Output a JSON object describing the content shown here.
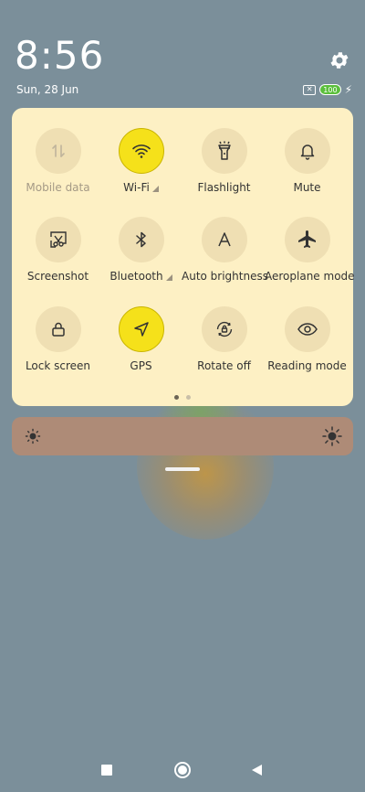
{
  "status": {
    "time": "8:56",
    "date": "Sun, 28 Jun",
    "battery": "100",
    "icons": [
      "settings-gear-icon",
      "sim-disabled-icon",
      "battery-icon",
      "charging-bolt-icon"
    ]
  },
  "tiles": [
    {
      "label": "Mobile data",
      "icon": "mobile-data-icon",
      "active": false,
      "disabled": true,
      "has_arrow": false
    },
    {
      "label": "Wi-Fi",
      "icon": "wifi-icon",
      "active": true,
      "disabled": false,
      "has_arrow": true
    },
    {
      "label": "Flashlight",
      "icon": "flashlight-icon",
      "active": false,
      "disabled": false,
      "has_arrow": false
    },
    {
      "label": "Mute",
      "icon": "bell-icon",
      "active": false,
      "disabled": false,
      "has_arrow": false
    },
    {
      "label": "Screenshot",
      "icon": "screenshot-icon",
      "active": false,
      "disabled": false,
      "has_arrow": false
    },
    {
      "label": "Bluetooth",
      "icon": "bluetooth-icon",
      "active": false,
      "disabled": false,
      "has_arrow": true
    },
    {
      "label": "Auto brightness",
      "icon": "auto-brightness-icon",
      "active": false,
      "disabled": false,
      "has_arrow": false
    },
    {
      "label": "Aeroplane mode",
      "icon": "airplane-icon",
      "active": false,
      "disabled": false,
      "has_arrow": false
    },
    {
      "label": "Lock screen",
      "icon": "lock-icon",
      "active": false,
      "disabled": false,
      "has_arrow": false
    },
    {
      "label": "GPS",
      "icon": "location-arrow-icon",
      "active": true,
      "disabled": false,
      "has_arrow": false
    },
    {
      "label": "Rotate off",
      "icon": "rotate-lock-icon",
      "active": false,
      "disabled": false,
      "has_arrow": false
    },
    {
      "label": "Reading mode",
      "icon": "eye-icon",
      "active": false,
      "disabled": false,
      "has_arrow": false
    }
  ],
  "pager": {
    "pages": 2,
    "current": 1
  },
  "brightness": {
    "level": 0.0
  },
  "colors": {
    "panel_bg": "#fdf0c4",
    "tile_bg": "#efdfb3",
    "tile_active": "#f5e11a",
    "brightness_bar": "#ae8b77",
    "wallpaper": "#7b8f9a",
    "battery_green": "#5bbf3c"
  },
  "navbar": {
    "buttons": [
      "recents-square-icon",
      "home-circle-icon",
      "back-triangle-icon"
    ]
  }
}
